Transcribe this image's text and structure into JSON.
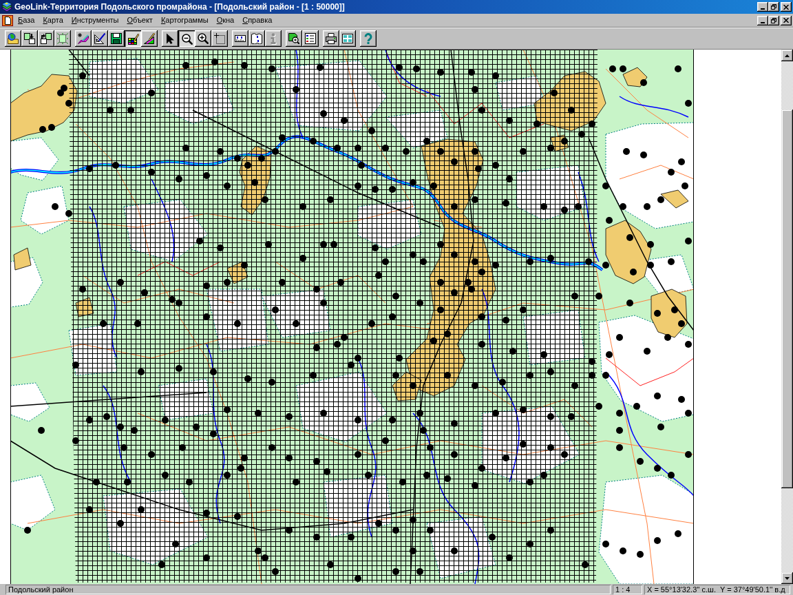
{
  "window": {
    "title": "GeoLink-Территория Подольского промрайона - [Подольский район - [1 : 50000]]"
  },
  "menu": [
    "База",
    "Карта",
    "Инструменты",
    "Объект",
    "Картограммы",
    "Окна",
    "Справка"
  ],
  "toolbar": {
    "groups": [
      [
        {
          "pressed": false,
          "disabled": false
        },
        {
          "pressed": false,
          "disabled": false
        },
        {
          "pressed": false,
          "disabled": false
        },
        {
          "pressed": false,
          "disabled": false
        }
      ],
      [
        {
          "pressed": false,
          "disabled": false
        },
        {
          "pressed": false,
          "disabled": false
        },
        {
          "pressed": false,
          "disabled": false
        },
        {
          "pressed": true,
          "disabled": false
        },
        {
          "pressed": false,
          "disabled": false
        }
      ],
      [
        {
          "pressed": false,
          "disabled": false
        },
        {
          "pressed": true,
          "disabled": false
        },
        {
          "pressed": false,
          "disabled": false
        },
        {
          "pressed": false,
          "disabled": false
        }
      ],
      [
        {
          "pressed": false,
          "disabled": false
        },
        {
          "pressed": false,
          "disabled": false
        },
        {
          "pressed": false,
          "disabled": true
        }
      ],
      [
        {
          "pressed": false,
          "disabled": false
        },
        {
          "pressed": false,
          "disabled": false
        }
      ],
      [
        {
          "pressed": false,
          "disabled": false
        },
        {
          "pressed": false,
          "disabled": false
        }
      ],
      [
        {
          "pressed": false,
          "disabled": false
        }
      ]
    ]
  },
  "status_bar": {
    "panels": [
      "Подольский район",
      "1 : 4",
      "X = 55°13'32.3'' с.ш.  Y = 37°49'50.1'' в.д"
    ]
  }
}
